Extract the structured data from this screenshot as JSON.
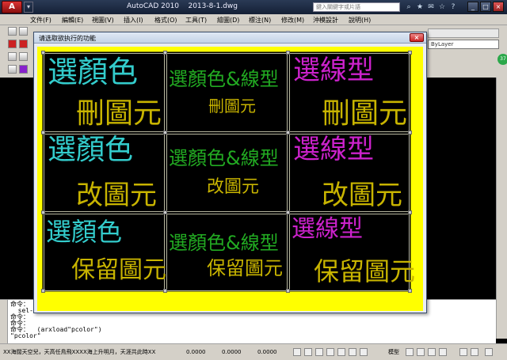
{
  "title_bar": {
    "window_title": "AutoCAD 2010    2013-8-1.dwg",
    "search_placeholder": "鍵入關鍵字或片語"
  },
  "menu": [
    "文件(F)",
    "編輯(E)",
    "視圖(V)",
    "插入(I)",
    "格式(O)",
    "工具(T)",
    "繪圖(D)",
    "標注(N)",
    "修改(M)",
    "沖模設計",
    "說明(H)"
  ],
  "toolbar": {
    "layer_combo": "ByLayer",
    "badge": "37"
  },
  "dialog": {
    "title": "请选取欲执行的功能",
    "close_label": "×",
    "cells": [
      {
        "top": "選顏色",
        "bottom": "刪圖元"
      },
      {
        "top": "選顏色&線型",
        "bottom": "刪圖元"
      },
      {
        "top": "選線型",
        "bottom": "刪圖元"
      },
      {
        "top": "選顏色",
        "bottom": "改圖元"
      },
      {
        "top": "選顏色&線型",
        "bottom": "改圖元"
      },
      {
        "top": "選線型",
        "bottom": "改圖元"
      },
      {
        "top": "選顏色",
        "bottom": "保留圖元"
      },
      {
        "top": "選顏色&線型",
        "bottom": "保留圖元"
      },
      {
        "top": "選線型",
        "bottom": "保留圖元"
      }
    ],
    "colors": {
      "color_text": "#33cccc",
      "both_text": "#22aa22",
      "linetype_text": "#cc22cc",
      "action_text": "#c8b400",
      "background": "#ffff00"
    }
  },
  "command_lines": [
    "命令：",
    "  sel-",
    "命令：",
    "命令：",
    "命令：  (arxload\"pcolor\")",
    "\"pcolor\""
  ],
  "status": {
    "message": "XX海闊天空兒，天高任鳥飛XXXX海上升明月，天涯共此時XX",
    "coords": [
      "0.0000",
      "0.0000",
      "0.0000"
    ],
    "model_tab": "模型"
  }
}
